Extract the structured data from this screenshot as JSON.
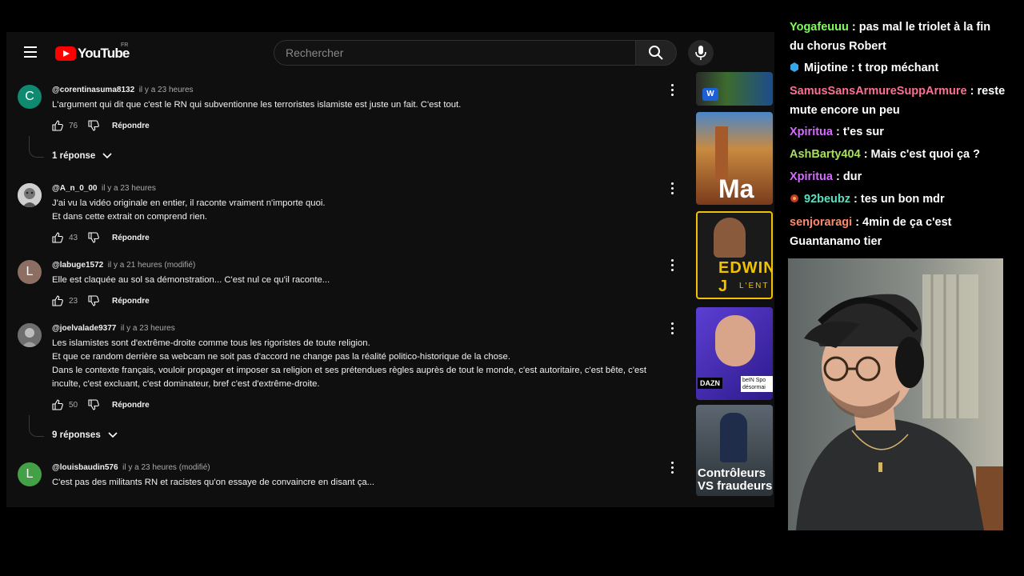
{
  "youtube": {
    "logo_text": "YouTube",
    "country": "FR",
    "search": {
      "placeholder": "Rechercher"
    },
    "comments": [
      {
        "avatar_letter": "C",
        "avatar_color": "#0d8a6f",
        "author": "@corentinasuma8132",
        "time": "il y a 23 heures",
        "lines": [
          "L'argument qui dit que c'est le RN qui subventionne les terroristes islamiste est juste un fait. C'est tout."
        ],
        "likes": "76",
        "reply_label": "Répondre",
        "replies_label": "1 réponse"
      },
      {
        "avatar_letter": "",
        "avatar_color": "#888888",
        "author": "@A_n_0_00",
        "time": "il y a 23 heures",
        "lines": [
          "J'ai vu la vidéo originale en entier, il raconte vraiment n'importe quoi.",
          "Et dans cette extrait on comprend rien."
        ],
        "likes": "43",
        "reply_label": "Répondre"
      },
      {
        "avatar_letter": "L",
        "avatar_color": "#8d6e63",
        "author": "@labuge1572",
        "time": "il y a 21 heures (modifié)",
        "lines": [
          "Elle est claquée au sol sa démonstration... C'est nul ce qu'il raconte..."
        ],
        "likes": "23",
        "reply_label": "Répondre"
      },
      {
        "avatar_letter": "",
        "avatar_color": "#666666",
        "author": "@joelvalade9377",
        "time": "il y a 23 heures",
        "lines": [
          "Les islamistes sont d'extrême-droite comme tous les rigoristes de toute religion.",
          "Et que ce random derrière sa webcam ne soit pas d'accord ne change pas la réalité politico-historique de la chose.",
          "Dans le contexte français, vouloir propager et imposer sa religion et ses prétendues règles auprès de tout le monde, c'est autoritaire, c'est bête, c'est",
          "inculte, c'est excluant, c'est dominateur, bref c'est d'extrême-droite."
        ],
        "likes": "50",
        "reply_label": "Répondre",
        "replies_label": "9 réponses"
      },
      {
        "avatar_letter": "L",
        "avatar_color": "#43a047",
        "author": "@louisbaudin576",
        "time": "il y a 23 heures (modifié)",
        "lines": [
          "C'est pas des militants RN et racistes qu'on essaye de convaincre en disant ça..."
        ],
        "likes": "",
        "reply_label": ""
      }
    ],
    "sidebar_thumbs": [
      {
        "text": "",
        "bg": "#1e3a5f"
      },
      {
        "text": "Ma",
        "bg": "#c9862f"
      },
      {
        "text": "EDWIN J",
        "sub": "L'ENT",
        "bg": "#1a1a1a"
      },
      {
        "text": "beIN Spo",
        "sub": "désormai",
        "tag": "DAZN",
        "bg": "#3b2fa0"
      },
      {
        "text": "Contrôleurs",
        "sub": "VS fraudeurs",
        "bg": "#4b5560"
      }
    ]
  },
  "chat": {
    "messages": [
      {
        "user": "Yogafeuuu",
        "color": "#7fff5a",
        "text": " : pas mal le triolet à la fin du chorus Robert"
      },
      {
        "user": "Mijotine",
        "color": "#ffffff",
        "badge": "#38a7e8",
        "text": " : t trop méchant"
      },
      {
        "user": "SamusSansArmureSuppArmure",
        "color": "#ff6f91",
        "text": " : reste mute encore un peu"
      },
      {
        "user": "Xpiritua",
        "color": "#d66bff",
        "text": " : t'es sur"
      },
      {
        "user": "AshBarty404",
        "color": "#a8e05a",
        "text": " : Mais c'est quoi ça ?"
      },
      {
        "user": "Xpiritua",
        "color": "#d66bff",
        "text": " : dur"
      },
      {
        "user": "92beubz",
        "color": "#58e0c0",
        "badge": "#c0392b",
        "text": " : tes un bon mdr"
      },
      {
        "user": "senjoraragi",
        "color": "#ff8a6b",
        "text": " : 4min de ça c'est Guantanamo tier"
      }
    ]
  }
}
